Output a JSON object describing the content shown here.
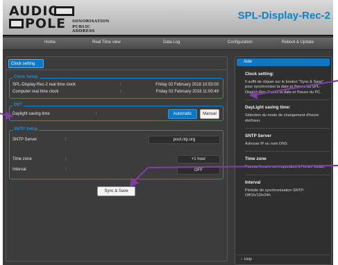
{
  "header": {
    "logo_line1": "AUDIO",
    "logo_line2": "POLE",
    "logo_sub1": "SONORISATION",
    "logo_sub2": "PUBLIC ADDRESS",
    "device_name": "SPL-Display-Rec-2"
  },
  "nav": {
    "items": [
      "Home",
      "Real Time view",
      "Data Log",
      "Configuration",
      "Reboot & Update"
    ]
  },
  "main": {
    "tab_label": "Clock setting",
    "clock_setup": {
      "legend": "Clock Setup",
      "rows": [
        {
          "label": "SPL-Display-Rec-2 real time clock",
          "value": "Friday 02 February 2018 10:53:03"
        },
        {
          "label": "Computer real time clock",
          "value": "Friday 02 February 2018 11:00:49"
        }
      ]
    },
    "dst": {
      "legend": "DST",
      "label": "Daylight saving time",
      "automatic_label": "Automatic",
      "manual_label": "Manual"
    },
    "sntp": {
      "legend": "SNTP Setup",
      "server_label": "SNTP Server",
      "server_value": "pool.ntp.org",
      "timezone_label": "Time zone",
      "timezone_value": "+1 hour",
      "interval_label": "Interval",
      "interval_value": "OFF"
    },
    "sync_button": "Sync & Save",
    "colon": ":"
  },
  "help": {
    "header": "Aide",
    "sections": [
      {
        "title": "Clock setting:",
        "text": "Il suffit de cliquer sur le bouton \"Sync & Save\" pour synchroniser la date et l'heure du SPL-Display-Rec-2 avec la date et l'heure du PC."
      },
      {
        "title": "DayLight saving time:",
        "text": "Sélection du mode de changement d'heure été/hiver."
      },
      {
        "title": "SNTP Server",
        "text": "Adresse IP ou nom DNS"
      },
      {
        "title": "Time zone",
        "text": "Fuseau horaire correspondant à l'heure locale."
      },
      {
        "title": "Interval",
        "text": "Période de synchronisation SNTP: Off/1h/12h/24h"
      }
    ],
    "footer": "Help"
  },
  "colors": {
    "accent": "#0d78c3",
    "title_blue": "#0e83c9",
    "arrow": "#7b3fa0"
  }
}
